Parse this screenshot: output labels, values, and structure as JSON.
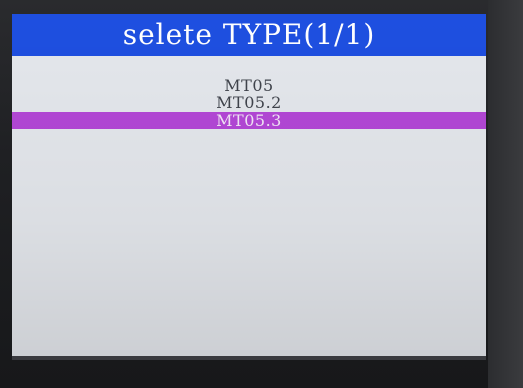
{
  "header": {
    "title": "selete TYPE(1/1)"
  },
  "list": {
    "items": [
      {
        "label": "MT05",
        "selected": false
      },
      {
        "label": "MT05.2",
        "selected": false
      },
      {
        "label": "MT05.3",
        "selected": true
      }
    ]
  },
  "colors": {
    "title_bar": "#1e4fe0",
    "selection": "#b347d6",
    "screen_bg": "#e4e7ec",
    "item_text": "#40444c"
  }
}
